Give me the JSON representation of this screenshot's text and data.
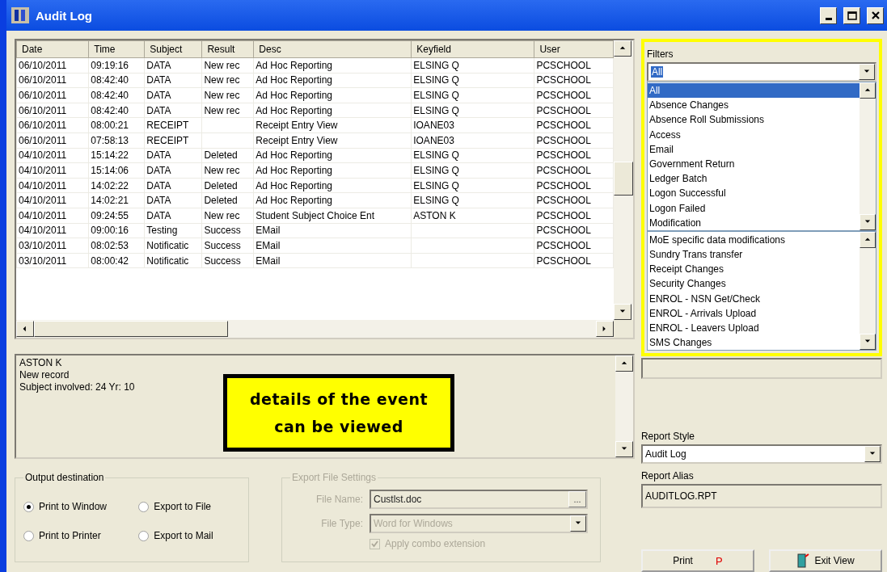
{
  "window": {
    "title": "Audit Log"
  },
  "table": {
    "columns": [
      "Date",
      "Time",
      "Subject",
      "Result",
      "Desc",
      "Keyfield",
      "User"
    ],
    "rows": [
      [
        "06/10/2011",
        "09:19:16",
        "DATA",
        "New rec",
        "Ad Hoc Reporting",
        "ELSING Q",
        "PCSCHOOL"
      ],
      [
        "06/10/2011",
        "08:42:40",
        "DATA",
        "New rec",
        "Ad Hoc Reporting",
        "ELSING Q",
        "PCSCHOOL"
      ],
      [
        "06/10/2011",
        "08:42:40",
        "DATA",
        "New rec",
        "Ad Hoc Reporting",
        "ELSING Q",
        "PCSCHOOL"
      ],
      [
        "06/10/2011",
        "08:42:40",
        "DATA",
        "New rec",
        "Ad Hoc Reporting",
        "ELSING Q",
        "PCSCHOOL"
      ],
      [
        "06/10/2011",
        "08:00:21",
        "RECEIPT",
        null,
        "Receipt Entry View",
        "IOANE03",
        "PCSCHOOL"
      ],
      [
        "06/10/2011",
        "07:58:13",
        "RECEIPT",
        null,
        "Receipt Entry View",
        "IOANE03",
        "PCSCHOOL"
      ],
      [
        "04/10/2011",
        "15:14:22",
        "DATA",
        "Deleted",
        "Ad Hoc Reporting",
        "ELSING Q",
        "PCSCHOOL"
      ],
      [
        "04/10/2011",
        "15:14:06",
        "DATA",
        "New rec",
        "Ad Hoc Reporting",
        "ELSING Q",
        "PCSCHOOL"
      ],
      [
        "04/10/2011",
        "14:02:22",
        "DATA",
        "Deleted",
        "Ad Hoc Reporting",
        "ELSING Q",
        "PCSCHOOL"
      ],
      [
        "04/10/2011",
        "14:02:21",
        "DATA",
        "Deleted",
        "Ad Hoc Reporting",
        "ELSING Q",
        "PCSCHOOL"
      ],
      [
        "04/10/2011",
        "09:24:55",
        "DATA",
        "New rec",
        "Student Subject Choice Ent",
        "ASTON K",
        "PCSCHOOL"
      ],
      [
        "04/10/2011",
        "09:00:16",
        "Testing",
        "Success",
        "EMail",
        null,
        "PCSCHOOL"
      ],
      [
        "03/10/2011",
        "08:02:53",
        "Notificatic",
        "Success",
        "EMail",
        null,
        "PCSCHOOL"
      ],
      [
        "03/10/2011",
        "08:00:42",
        "Notificatic",
        "Success",
        "EMail",
        null,
        "PCSCHOOL"
      ]
    ]
  },
  "details": {
    "lines": [
      "ASTON K",
      "New record",
      "Subject involved: 24 Yr: 10"
    ]
  },
  "callout": {
    "lines": [
      "details of the event",
      "can be viewed"
    ]
  },
  "output_destination": {
    "title": "Output destination",
    "options": [
      {
        "label": "Print to Window",
        "selected": true
      },
      {
        "label": "Export to File",
        "selected": false
      },
      {
        "label": "Print to Printer",
        "selected": false
      },
      {
        "label": "Export to Mail",
        "selected": false
      }
    ]
  },
  "export_settings": {
    "title": "Export File Settings",
    "disabled": true,
    "file_name_label": "File Name:",
    "file_name": "Custlst.doc",
    "browse": "...",
    "file_type_label": "File Type:",
    "file_type": "Word for Windows",
    "apply_combo": {
      "label": "Apply combo extension",
      "checked": true
    }
  },
  "filters": {
    "label": "Filters",
    "value": "All",
    "list": [
      {
        "label": "All",
        "selected": true
      },
      {
        "label": "Absence Changes",
        "selected": false
      },
      {
        "label": "Absence Roll Submissions",
        "selected": false
      },
      {
        "label": "Access",
        "selected": false
      },
      {
        "label": "Email",
        "selected": false
      },
      {
        "label": "Government Return",
        "selected": false
      },
      {
        "label": "Ledger Batch",
        "selected": false
      },
      {
        "label": "Logon Successful",
        "selected": false
      },
      {
        "label": "Logon Failed",
        "selected": false
      },
      {
        "label": "Modification",
        "selected": false
      }
    ],
    "more_list": [
      {
        "label": "MoE specific data modifications",
        "selected": false
      },
      {
        "label": "Sundry Trans transfer",
        "selected": false
      },
      {
        "label": "Receipt Changes",
        "selected": false
      },
      {
        "label": "Security Changes",
        "selected": false
      },
      {
        "label": "ENROL - NSN Get/Check",
        "selected": false
      },
      {
        "label": "ENROL - Arrivals Upload",
        "selected": false
      },
      {
        "label": "ENROL - Leavers Upload",
        "selected": false
      },
      {
        "label": "SMS Changes",
        "selected": false
      }
    ]
  },
  "report_style": {
    "label": "Report Style",
    "value": "Audit Log"
  },
  "report_alias": {
    "label": "Report Alias",
    "value": "AUDITLOG.RPT"
  },
  "buttons": {
    "print": {
      "label": "Print",
      "hotkey": "P"
    },
    "exit": {
      "label": "Exit View"
    }
  }
}
